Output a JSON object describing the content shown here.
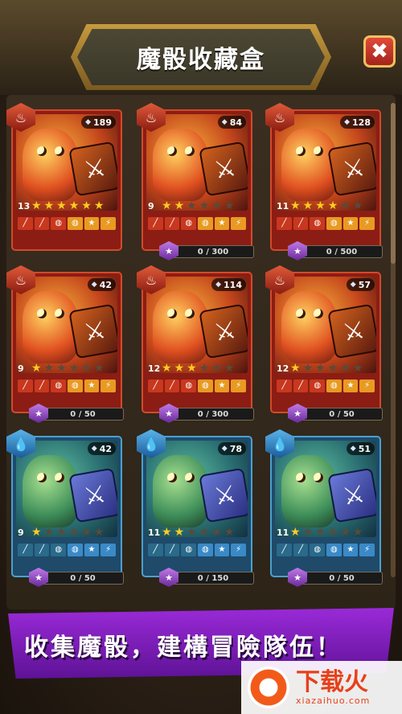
{
  "window": {
    "title": "魔骰收藏盒"
  },
  "header": {
    "close_icon": "close-icon",
    "close_glyph": "✖"
  },
  "cards": [
    {
      "element": "fire",
      "class_icon": "fire-class-icon",
      "count": "189",
      "level": "13",
      "stars": 6,
      "progress": ""
    },
    {
      "element": "fire",
      "class_icon": "fire-class-icon",
      "count": "84",
      "level": "9",
      "stars": 2,
      "progress": "0 / 300"
    },
    {
      "element": "fire",
      "class_icon": "fire-class-icon",
      "count": "128",
      "level": "11",
      "stars": 4,
      "progress": "0 / 500"
    },
    {
      "element": "fire",
      "class_icon": "fire-class-icon",
      "count": "42",
      "level": "9",
      "stars": 1,
      "progress": "0 / 50"
    },
    {
      "element": "fire",
      "class_icon": "fire-class-icon",
      "count": "114",
      "level": "12",
      "stars": 3,
      "progress": "0 / 300"
    },
    {
      "element": "fire",
      "class_icon": "fire-class-icon",
      "count": "57",
      "level": "12",
      "stars": 1,
      "progress": "0 / 50"
    },
    {
      "element": "water",
      "class_icon": "water-class-icon",
      "count": "42",
      "level": "9",
      "stars": 1,
      "progress": "0 / 50"
    },
    {
      "element": "water",
      "class_icon": "water-class-icon",
      "count": "78",
      "level": "11",
      "stars": 2,
      "progress": "0 / 150"
    },
    {
      "element": "water",
      "class_icon": "water-class-icon",
      "count": "51",
      "level": "11",
      "stars": 1,
      "progress": "0 / 50"
    }
  ],
  "banner": {
    "text": "收集魔骰，建構冒險隊伍！"
  },
  "watermark": {
    "main": "下载火",
    "sub": "xiazaihuo.com"
  },
  "colors": {
    "fire": "#8c1d14",
    "water": "#1f4a6a",
    "accent_gold": "#ffcc22",
    "banner_purple": "#9a2ad8"
  }
}
